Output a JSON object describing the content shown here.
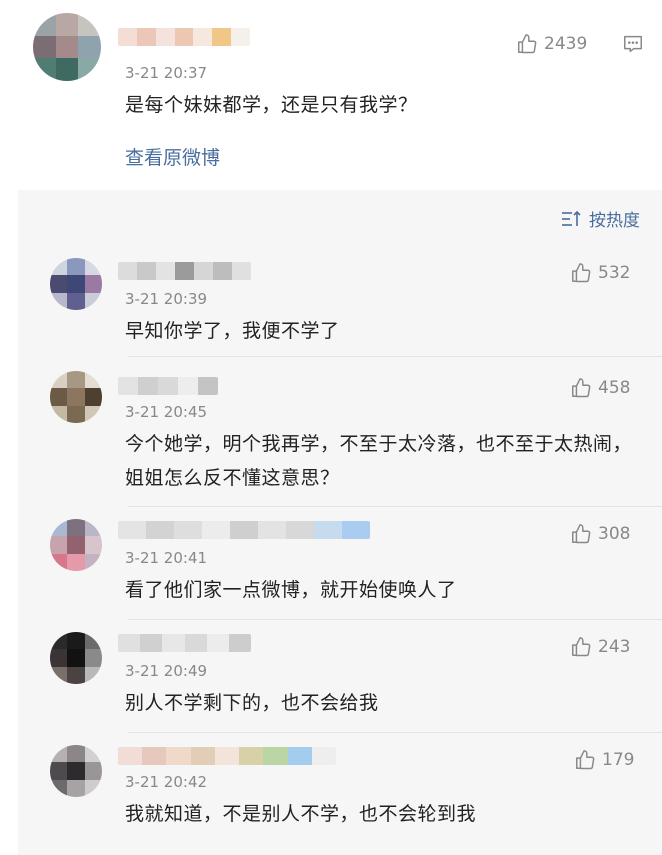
{
  "main": {
    "time": "3-21 20:37",
    "text": "是每个妹妹都学，还是只有我学？",
    "likes": "2439",
    "view_original": "查看原微博",
    "icons": {
      "like": "thumbs-up-icon",
      "comment": "comment-icon"
    }
  },
  "sort": {
    "label": "按热度",
    "icon": "sort-icon"
  },
  "replies": [
    {
      "time": "3-21 20:39",
      "likes": "532",
      "text": "早知你学了，我便不学了"
    },
    {
      "time": "3-21 20:45",
      "likes": "458",
      "text": "今个她学，明个我再学，不至于太冷落，也不至于太热闹，姐姐怎么反不懂这意思？"
    },
    {
      "time": "3-21 20:41",
      "likes": "308",
      "text": "看了他们家一点微博，就开始使唤人了"
    },
    {
      "time": "3-21 20:49",
      "likes": "243",
      "text": "别人不学剩下的，也不会给我"
    },
    {
      "time": "3-21 20:42",
      "likes": "179",
      "text": "我就知道，不是别人不学，也不会轮到我"
    }
  ],
  "colors": {
    "link": "#4a6da0",
    "meta": "#888888",
    "reply_bg": "#f6f6f6"
  }
}
